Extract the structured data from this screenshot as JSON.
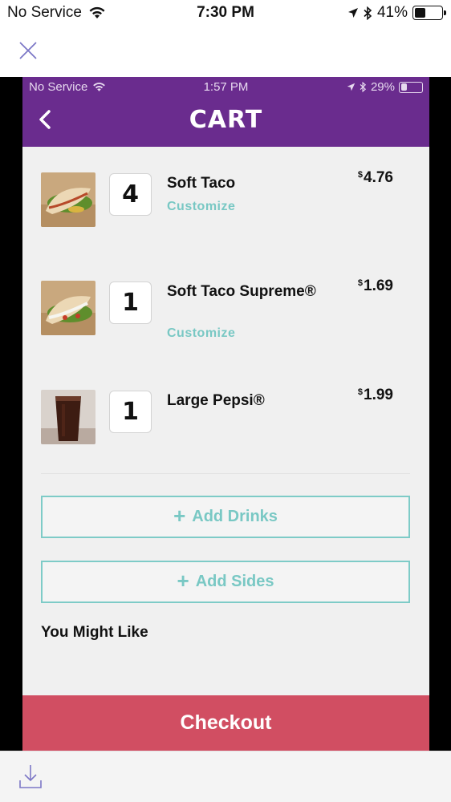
{
  "outer_status": {
    "carrier": "No Service",
    "time": "7:30 PM",
    "battery": "41%",
    "battery_level": 0.41
  },
  "inner_status": {
    "carrier": "No Service",
    "time": "1:57 PM",
    "battery": "29%",
    "battery_level": 0.29
  },
  "header": {
    "title": "CART"
  },
  "items": [
    {
      "qty": "4",
      "name": "Soft Taco",
      "customize": "Customize",
      "price_symbol": "$",
      "price": "4.76",
      "image": "soft-taco"
    },
    {
      "qty": "1",
      "name": "Soft Taco Supreme®",
      "customize": "Customize",
      "price_symbol": "$",
      "price": "1.69",
      "image": "soft-taco-supreme"
    },
    {
      "qty": "1",
      "name": "Large Pepsi®",
      "price_symbol": "$",
      "price": "1.99",
      "image": "large-pepsi"
    }
  ],
  "add_drinks": {
    "label": "Add Drinks",
    "icon": "plus-icon"
  },
  "add_sides": {
    "label": "Add Sides",
    "icon": "plus-icon"
  },
  "might_like": "You Might Like",
  "checkout": "Checkout",
  "colors": {
    "header": "#6a2c8e",
    "accent": "#79c8c4",
    "checkout": "#d14e62"
  }
}
